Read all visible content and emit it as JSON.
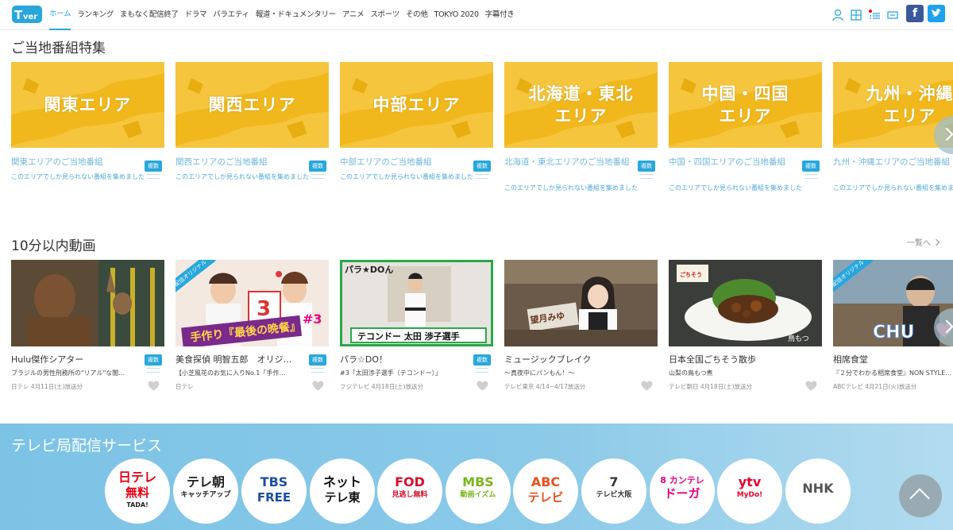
{
  "header": {
    "logo": "TVer",
    "nav": [
      "ホーム",
      "ランキング",
      "まもなく配信終了",
      "ドラマ",
      "バラエティ",
      "報道・ドキュメンタリー",
      "アニメ",
      "スポーツ",
      "その他",
      "TOKYO 2020",
      "字幕付き"
    ],
    "active_nav": "ホーム",
    "icons": [
      "user-icon",
      "grid-icon",
      "list-icon",
      "tv-icon"
    ],
    "sns": [
      "f",
      "twitter-bird"
    ]
  },
  "local": {
    "title": "ご当地番組特集",
    "cards": [
      {
        "label_l1": "関東エリア",
        "label_l2": "",
        "title": "関東エリアのご当地番組",
        "desc": "このエリアでしか見られない番組を集めました",
        "badge": "複数"
      },
      {
        "label_l1": "関西エリア",
        "label_l2": "",
        "title": "関西エリアのご当地番組",
        "desc": "このエリアでしか見られない番組を集めました",
        "badge": "複数"
      },
      {
        "label_l1": "中部エリア",
        "label_l2": "",
        "title": "中部エリアのご当地番組",
        "desc": "このエリアでしか見られない番組を集めました",
        "badge": "複数"
      },
      {
        "label_l1": "北海道・東北",
        "label_l2": "エリア",
        "title": "北海道・東北エリアのご当地番組",
        "desc": "このエリアでしか見られない番組を集めました",
        "badge": "複数"
      },
      {
        "label_l1": "中国・四国",
        "label_l2": "エリア",
        "title": "中国・四国エリアのご当地番組",
        "desc": "このエリアでしか見られない番組を集めました",
        "badge": "複数"
      },
      {
        "label_l1": "九州・沖縄",
        "label_l2": "エリア",
        "title": "九州・沖縄エリアのご当地番組",
        "desc": "このエリアでしか見られない番組を集めました",
        "badge": ""
      }
    ]
  },
  "short": {
    "title": "10分以内動画",
    "more": "一覧へ",
    "cards": [
      {
        "title": "Hulu傑作シアター",
        "desc": "ブラジルの男性刑務所の\"リアル\"な闇…",
        "meta": "日テレ 4月11日(土)放送分",
        "badge": "複数",
        "original": "",
        "thumb_text": ""
      },
      {
        "title": "美食探偵 明智五郎　オリジ…",
        "desc": "【小芝風花のお気に入りNo.1「手作…",
        "meta": "日テレ",
        "badge": "複数",
        "original": "配信オリジナル",
        "thumb_text": "最後の晩餐"
      },
      {
        "title": "パラ☆DO！",
        "desc": "#3「太田渉子選手（テコンドー）」",
        "meta": "フジテレビ 4月18日(土)放送分",
        "badge": "複数",
        "original": "",
        "thumb_text": "テコンドー 太田 渉子選手"
      },
      {
        "title": "ミュージックブレイク",
        "desc": "～真夜中にパンもん！～",
        "meta": "テレビ東京 4/14~4/17放送分",
        "badge": "",
        "original": "",
        "thumb_text": "望月みゆ"
      },
      {
        "title": "日本全国ごちそう散歩",
        "desc": "山梨の鳥もつ煮",
        "meta": "テレビ朝日 4月18日(土)放送分",
        "badge": "",
        "original": "",
        "thumb_text": "鳥もつ"
      },
      {
        "title": "相席食堂",
        "desc": "『２分でわかる相席食堂』NON STYLE…",
        "meta": "ABCテレビ 4月21日(火)放送分",
        "badge": "",
        "original": "配信オリジナル",
        "thumb_text": "CHU"
      }
    ]
  },
  "services": {
    "title": "テレビ局配信サービス",
    "items": [
      {
        "l1": "日テレ",
        "l2": "無料",
        "l3": "TADA!",
        "color": "#e60012"
      },
      {
        "l1": "テレ朝",
        "l2": "キャッチアップ",
        "l3": "",
        "color": "#222222"
      },
      {
        "l1": "TBS",
        "l2": "FREE",
        "l3": "",
        "color": "#1a4fa0"
      },
      {
        "l1": "ネット",
        "l2": "テレ東",
        "l3": "",
        "color": "#111111"
      },
      {
        "l1": "FOD",
        "l2": "見逃し無料",
        "l3": "",
        "color": "#d60f2a"
      },
      {
        "l1": "MBS",
        "l2": "動画イズム",
        "l3": "",
        "color": "#7ab51d"
      },
      {
        "l1": "ABC",
        "l2": "テレビ",
        "l3": "",
        "color": "#e8501c"
      },
      {
        "l1": "7",
        "l2": "テレビ大阪",
        "l3": "",
        "color": "#333333"
      },
      {
        "l1": "8 カンテレ",
        "l2": "ドーガ",
        "l3": "",
        "color": "#e4007f"
      },
      {
        "l1": "ytv",
        "l2": "MyDo!",
        "l3": "",
        "color": "#e6002d"
      },
      {
        "l1": "NHK",
        "l2": "",
        "l3": "",
        "color": "#555555"
      }
    ]
  },
  "colors": {
    "accent": "#28a7dc",
    "area_yellow": "#f1b81d",
    "band": "#7cc3e6"
  }
}
